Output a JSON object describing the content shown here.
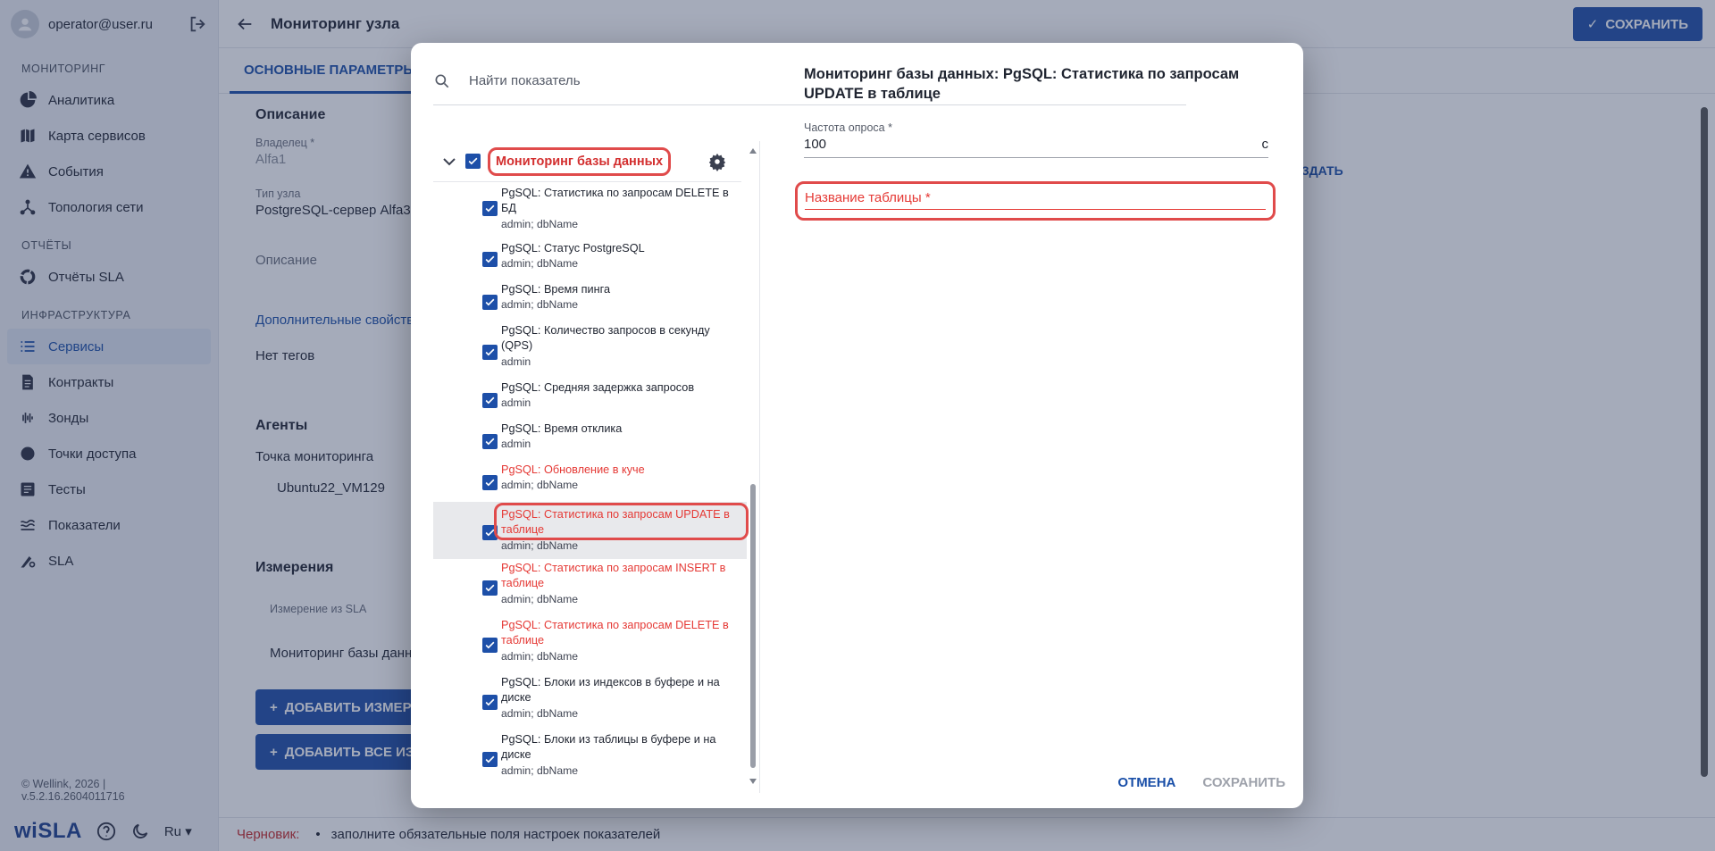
{
  "user": {
    "email": "operator@user.ru"
  },
  "sidebar": {
    "sections": [
      {
        "title": "МОНИТОРИНГ",
        "items": [
          {
            "label": "Аналитика",
            "icon": "pie-chart-icon"
          },
          {
            "label": "Карта сервисов",
            "icon": "map-icon"
          },
          {
            "label": "События",
            "icon": "warning-icon"
          },
          {
            "label": "Топология сети",
            "icon": "topology-icon"
          }
        ]
      },
      {
        "title": "ОТЧЁТЫ",
        "items": [
          {
            "label": "Отчёты SLA",
            "icon": "ring-icon"
          }
        ]
      },
      {
        "title": "ИНФРАСТРУКТУРА",
        "items": [
          {
            "label": "Сервисы",
            "icon": "list-icon",
            "active": true
          },
          {
            "label": "Контракты",
            "icon": "document-icon"
          },
          {
            "label": "Зонды",
            "icon": "signal-icon"
          },
          {
            "label": "Точки доступа",
            "icon": "dot-icon"
          },
          {
            "label": "Тесты",
            "icon": "tests-icon"
          },
          {
            "label": "Показатели",
            "icon": "metrics-icon"
          },
          {
            "label": "SLA",
            "icon": "sla-icon"
          }
        ]
      }
    ],
    "copyright": "© Wellink, 2026 | v.5.2.16.2604011716",
    "brand": "wiSLA",
    "language": "Ru"
  },
  "header": {
    "title": "Мониторинг узла",
    "save_label": "СОХРАНИТЬ"
  },
  "tabs": {
    "main": "ОСНОВНЫЕ ПАРАМЕТРЫ"
  },
  "main": {
    "description_title": "Описание",
    "owner_label": "Владелец *",
    "owner_value": "Alfa1",
    "node_type_label": "Тип узла",
    "node_type_value": "PostgreSQL-сервер Alfa3",
    "description_placeholder": "Описание",
    "extra_props_link": "Дополнительные свойства",
    "no_tags": "Нет тегов",
    "create_link": "ОЗДАТЬ",
    "agents_title": "Агенты",
    "monitoring_point_label": "Точка мониторинга",
    "monitoring_point_value": "Ubuntu22_VM129",
    "measurements_title": "Измерения",
    "measurement_col": "Измерение из SLA",
    "measurement_row": "Мониторинг базы данн",
    "add_measure_btn": "ДОБАВИТЬ ИЗМЕР",
    "add_all_btn": "ДОБАВИТЬ ВСЕ ИЗ"
  },
  "draft": {
    "tag": "Черновик:",
    "message": "заполните обязательные поля настроек показателей"
  },
  "dialog": {
    "search_placeholder": "Найти показатель",
    "group_label": "Мониторинг базы данных",
    "items": [
      {
        "name": "PgSQL: Статистика по запросам DELETE в БД",
        "sub": "admin; dbName",
        "red": false
      },
      {
        "name": "PgSQL: Статус PostgreSQL",
        "sub": "admin; dbName",
        "red": false
      },
      {
        "name": "PgSQL: Время пинга",
        "sub": "admin; dbName",
        "red": false
      },
      {
        "name": "PgSQL: Количество запросов в секунду (QPS)",
        "sub": "admin",
        "red": false
      },
      {
        "name": "PgSQL: Средняя задержка запросов",
        "sub": "admin",
        "red": false
      },
      {
        "name": "PgSQL: Время отклика",
        "sub": "admin",
        "red": false
      },
      {
        "name": "PgSQL: Обновление в куче",
        "sub": "admin; dbName",
        "red": true
      },
      {
        "name": "PgSQL: Статистика по запросам UPDATE в таблице",
        "sub": "admin; dbName",
        "red": true,
        "selected": true
      },
      {
        "name": "PgSQL: Статистика по запросам INSERT в таблице",
        "sub": "admin; dbName",
        "red": true
      },
      {
        "name": "PgSQL: Статистика по запросам DELETE в таблице",
        "sub": "admin; dbName",
        "red": true
      },
      {
        "name": "PgSQL: Блоки из индексов в буфере и на диске",
        "sub": "admin; dbName",
        "red": false
      },
      {
        "name": "PgSQL: Блоки из таблицы в буфере и на диске",
        "sub": "admin; dbName",
        "red": false
      }
    ],
    "detail_title": "Мониторинг базы данных: PgSQL: Статистика по запросам UPDATE в таблице",
    "freq_label": "Частота опроса *",
    "freq_value": "100",
    "freq_unit": "с",
    "table_name_label": "Название таблицы *",
    "cancel_label": "ОТМЕНА",
    "save_label": "СОХРАНИТЬ"
  },
  "colors": {
    "accent": "#1f4fa8",
    "error": "#e53935",
    "overlay": "#28385a"
  }
}
